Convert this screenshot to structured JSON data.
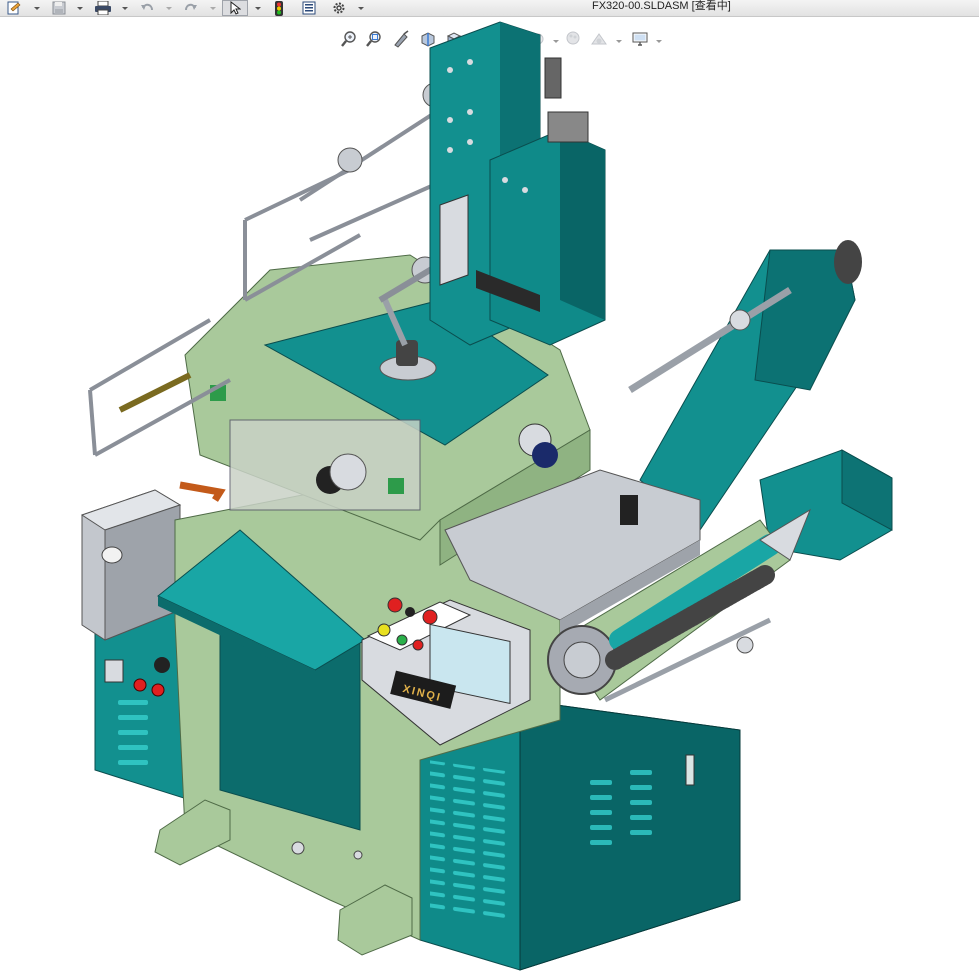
{
  "window": {
    "document_title": "FX320-00.SLDASM [查看中]"
  },
  "quick_access": {
    "items": [
      {
        "name": "new-document-icon"
      },
      {
        "name": "save-icon"
      },
      {
        "name": "print-icon"
      },
      {
        "name": "undo-icon"
      },
      {
        "name": "redo-icon"
      },
      {
        "name": "select-arrow-icon"
      },
      {
        "name": "rebuild-traffic-light-icon"
      },
      {
        "name": "file-properties-icon"
      },
      {
        "name": "options-gear-icon"
      }
    ]
  },
  "view_toolbar": {
    "items": [
      {
        "name": "zoom-to-fit-icon"
      },
      {
        "name": "zoom-to-area-icon"
      },
      {
        "name": "previous-view-icon"
      },
      {
        "name": "section-view-icon"
      },
      {
        "name": "view-orientation-icon"
      },
      {
        "name": "display-style-icon"
      },
      {
        "name": "hide-show-items-icon"
      },
      {
        "name": "edit-appearance-icon"
      },
      {
        "name": "apply-scene-icon"
      },
      {
        "name": "view-settings-icon"
      }
    ]
  },
  "machine": {
    "brand_plate": "XINQI",
    "colors": {
      "teal": "#12908f",
      "teal_dark": "#0a5f60",
      "green_body": "#a9c99b",
      "green_dark": "#6f9065",
      "steel": "#a8acb6",
      "panel_grey": "#c8ccd2"
    }
  }
}
